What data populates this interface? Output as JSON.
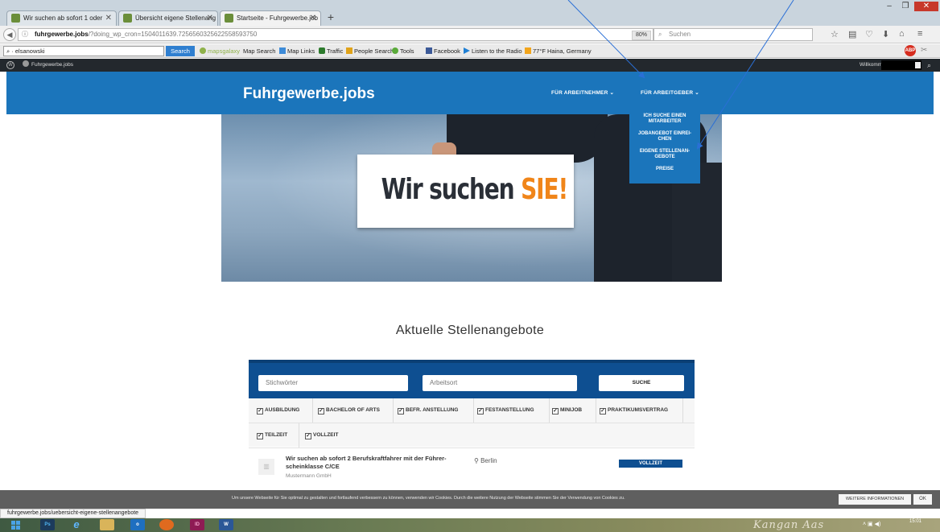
{
  "browser": {
    "tabs": [
      {
        "label": "Wir suchen ab sofort 1 oder"
      },
      {
        "label": "Übersicht eigene Stellenang"
      },
      {
        "label": "Startseite - Fuhrgewerbe.job"
      }
    ],
    "url_host": "fuhrgewerbe.jobs",
    "url_path": "/?doing_wp_cron=1504011639.7256560325622558593750",
    "zoom": "80%",
    "search_placeholder": "Suchen"
  },
  "toolbar": {
    "input_value": "elsanowski",
    "search_label": "Search",
    "items": [
      {
        "label": "mapsgalaxy",
        "icon": "mapsgalaxy-logo-icon",
        "color": "#8fb24a"
      },
      {
        "label": "Map Search",
        "icon": "map-search-icon",
        "color": "#ffffff"
      },
      {
        "label": "Map Links",
        "icon": "map-links-icon",
        "color": "#3d8bd8"
      },
      {
        "label": "Traffic",
        "icon": "traffic-light-icon",
        "color": "#2c7a2c"
      },
      {
        "label": "People Search",
        "icon": "people-search-icon",
        "color": "#e0a31a"
      },
      {
        "label": "Tools",
        "icon": "tools-icon",
        "color": "#5aaa3a"
      },
      {
        "label": "Facebook",
        "icon": "facebook-icon",
        "color": "#3b5998"
      },
      {
        "label": "Listen to the Radio",
        "icon": "play-icon",
        "color": "#1f7fd4"
      },
      {
        "label": "77°F Haina, Germany",
        "icon": "weather-icon",
        "color": "#f2a51c"
      }
    ]
  },
  "wpbar": {
    "site_name": "Fuhrgewerbe.jobs",
    "welcome": "Willkommen"
  },
  "site": {
    "logo": "Fuhrgewerbe.jobs",
    "nav": [
      {
        "label": "FÜR ARBEITNEHMER ⌄"
      },
      {
        "label": "FÜR ARBEITGEBER ⌄"
      }
    ],
    "dropdown": [
      {
        "label": "ICH SUCHE EINEN MITARBEITER"
      },
      {
        "label": "JOBANGEBOT EINREI-CHEN"
      },
      {
        "label": "EIGENE STELLENAN-GEBOTE"
      },
      {
        "label": "PREISE"
      }
    ],
    "brand_color": "#1b75bb"
  },
  "hero": {
    "sign_text": "Wir suchen",
    "sign_highlight": "SIE!",
    "highlight_color": "#f08519"
  },
  "jobs": {
    "title": "Aktuelle Stellenangebote",
    "keyword_placeholder": "Stichwörter",
    "location_placeholder": "Arbeitsort",
    "search_label": "SUCHE",
    "filters": [
      {
        "label": "AUSBILDUNG"
      },
      {
        "label": "BACHELOR OF ARTS"
      },
      {
        "label": "BEFR. ANSTELLUNG"
      },
      {
        "label": "FESTANSTELLUNG"
      },
      {
        "label": "MINIJOB"
      },
      {
        "label": "PRAKTIKUMSVERTRAG"
      },
      {
        "label": "TEILZEIT"
      },
      {
        "label": "VOLLZEIT"
      }
    ],
    "listing": {
      "title": "Wir suchen ab sofort 2 Berufskraftfahrer mit der Führer-scheinklasse C/CE",
      "company": "Mustermann GmbH",
      "location": "Berlin",
      "type": "VOLLZEIT"
    }
  },
  "cookie": {
    "text": "Um unsere Webseite für Sie optimal zu gestalten und fortlaufend verbessern zu können, verwenden wir Cookies. Durch die weitere Nutzung der Webseite stimmen Sie der Verwendung von Cookies zu.",
    "more_label": "WEITERE INFORMATIONEN",
    "ok_label": "OK"
  },
  "status_url": "fuhrgewerbe.jobs/uebersicht-eigene-stellenangebote",
  "taskbar": {
    "apps": [
      {
        "label": "Ps",
        "color": "#1c3b5c"
      },
      {
        "label": "e",
        "color": "#1a73c9"
      },
      {
        "label": "",
        "color": "#d9b45a"
      },
      {
        "label": "o",
        "color": "#1e6fc0"
      },
      {
        "label": "",
        "color": "#e06a1f"
      },
      {
        "label": "ID",
        "color": "#8e1b54"
      },
      {
        "label": "W",
        "color": "#2b5797"
      }
    ],
    "signature": "Kangan Aas",
    "time": "15:01"
  }
}
